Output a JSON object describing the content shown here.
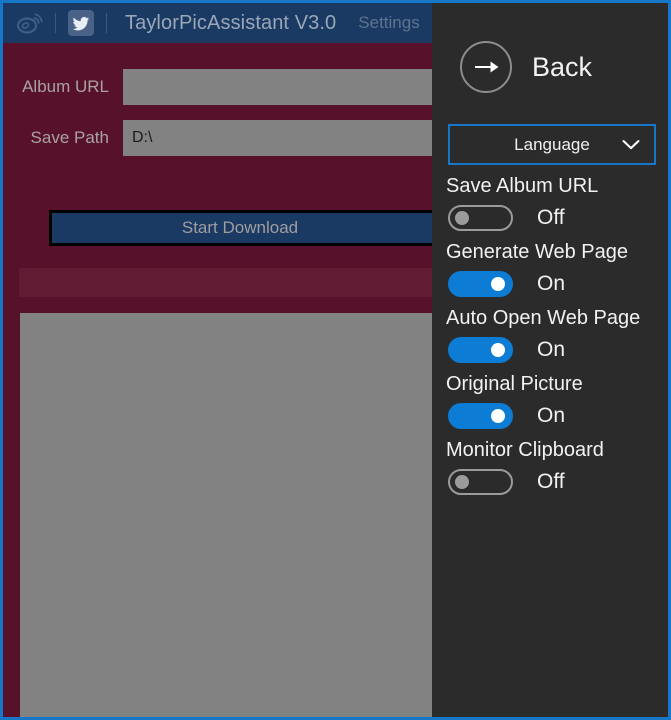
{
  "window": {
    "accent_border_color": "#1676c8",
    "panel_bg_color": "#2b2b2b",
    "body_bg_color": "#58112a",
    "titlebar_bg_color": "#1a3a63"
  },
  "titlebar": {
    "weibo_icon": "weibo-icon",
    "twitter_icon": "twitter-icon",
    "title": "TaylorPicAssistant V3.0",
    "settings_label": "Settings"
  },
  "form": {
    "album_url": {
      "label": "Album URL",
      "value": "",
      "placeholder": ""
    },
    "save_path": {
      "label": "Save Path",
      "value": "D:\\",
      "placeholder": ""
    },
    "start_download_label": "Start Download"
  },
  "settings": {
    "back_label": "Back",
    "back_icon": "arrow-right-circle-icon",
    "language": {
      "label": "Language",
      "chevron_icon": "chevron-down-icon",
      "border_color": "#1676c8"
    },
    "toggle_on_color": "#0c7cd5",
    "toggle_off_color": "#9b9b9b",
    "items": [
      {
        "title": "Save Album URL",
        "state": "Off",
        "on": false
      },
      {
        "title": "Generate Web Page",
        "state": "On",
        "on": true
      },
      {
        "title": "Auto Open Web Page",
        "state": "On",
        "on": true
      },
      {
        "title": "Original Picture",
        "state": "On",
        "on": true
      },
      {
        "title": "Monitor Clipboard",
        "state": "Off",
        "on": false
      }
    ]
  }
}
